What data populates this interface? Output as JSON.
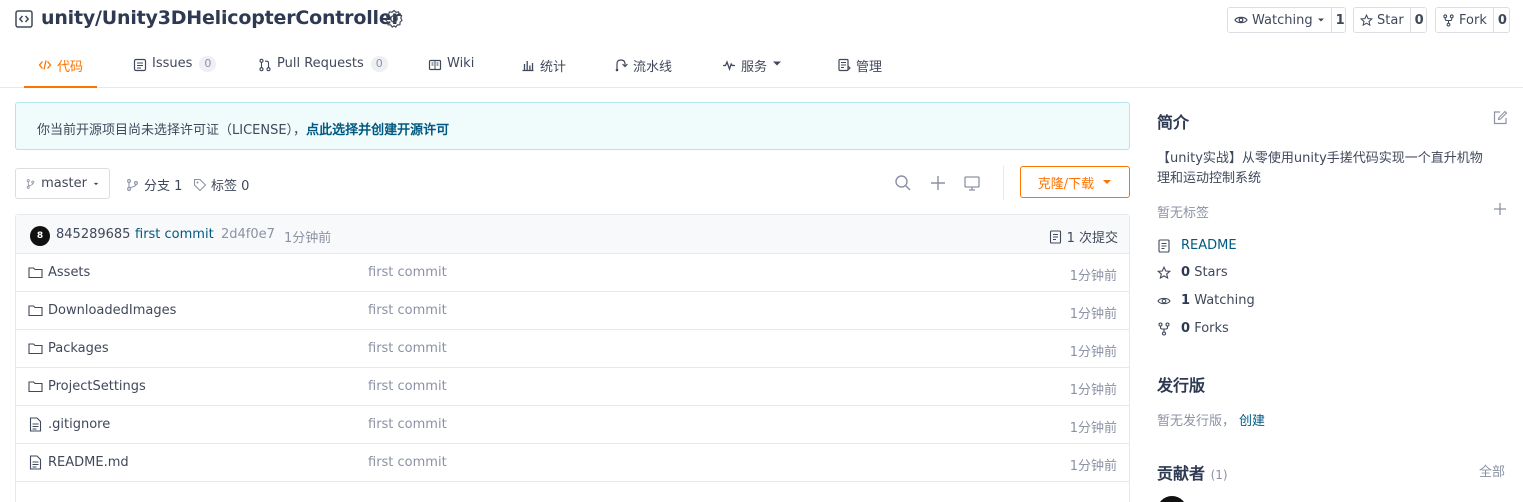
{
  "repo": {
    "title": "unity/Unity3DHelicopterController",
    "icon": "repo-icon",
    "gvp_icon": "badge-icon"
  },
  "actions": {
    "watching_label": "Watching",
    "watching_count": "1",
    "star_label": "Star",
    "star_count": "0",
    "fork_label": "Fork",
    "fork_count": "0"
  },
  "tabs": [
    {
      "label": "代码",
      "icon": "code-icon",
      "active": true
    },
    {
      "label": "Issues",
      "badge": "0",
      "icon": "issues-icon"
    },
    {
      "label": "Pull Requests",
      "badge": "0",
      "icon": "pull-request-icon"
    },
    {
      "label": "Wiki",
      "icon": "wiki-icon"
    },
    {
      "label": "统计",
      "icon": "stats-icon"
    },
    {
      "label": "流水线",
      "icon": "pipeline-icon"
    },
    {
      "label": "服务",
      "icon": "pulse-icon",
      "dropdown": true
    },
    {
      "label": "管理",
      "icon": "manage-icon"
    }
  ],
  "notice": {
    "text": "你当前开源项目尚未选择许可证（LICENSE），",
    "link": "点此选择并创建开源许可"
  },
  "branch": {
    "current": "master",
    "branches_label": "分支 1",
    "tags_label": "标签 0",
    "clone_label": "克隆/下载"
  },
  "commit": {
    "avatar_text": "8",
    "author": "845289685",
    "message": "first commit",
    "hash": "2d4f0e7",
    "time": "1分钟前",
    "count_label": "1 次提交"
  },
  "files": [
    {
      "name": "Assets",
      "type": "folder",
      "message": "first commit",
      "time": "1分钟前"
    },
    {
      "name": "DownloadedImages",
      "type": "folder",
      "message": "first commit",
      "time": "1分钟前"
    },
    {
      "name": "Packages",
      "type": "folder",
      "message": "first commit",
      "time": "1分钟前"
    },
    {
      "name": "ProjectSettings",
      "type": "folder",
      "message": "first commit",
      "time": "1分钟前"
    },
    {
      "name": ".gitignore",
      "type": "file",
      "message": "first commit",
      "time": "1分钟前"
    },
    {
      "name": "README.md",
      "type": "file",
      "message": "first commit",
      "time": "1分钟前"
    }
  ],
  "sidebar": {
    "intro_heading": "简介",
    "description_line1": "【unity实战】从零使用unity手搓代码实现一个直升机物",
    "description_line2": "理和运动控制系统",
    "no_tags": "暂无标签",
    "readme": "README",
    "stars_count": "0",
    "stars_label": "Stars",
    "watching_count": "1",
    "watching_label": "Watching",
    "forks_count": "0",
    "forks_label": "Forks",
    "releases_heading": "发行版",
    "no_releases": "暂无发行版，",
    "create_link": "创建",
    "contributors_heading": "贡献者",
    "contributors_count": "(1)",
    "all_link": "全部"
  },
  "colors": {
    "accent": "#fe7300",
    "link": "#005980",
    "text": "#40485b",
    "muted": "#8c92a4",
    "border": "#e3e9ed"
  }
}
